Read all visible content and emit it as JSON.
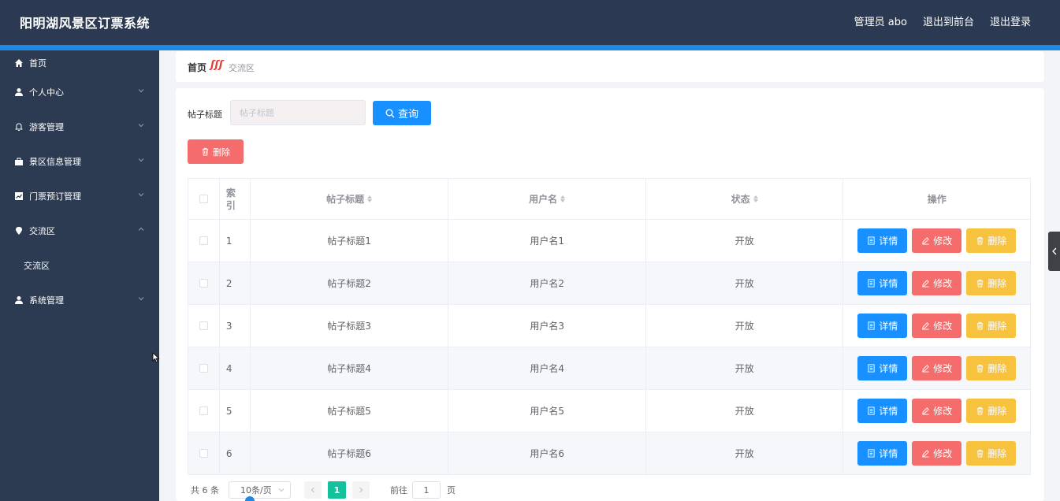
{
  "header": {
    "title": "阳明湖风景区订票系统",
    "admin": "管理员 abo",
    "back_to_front": "退出到前台",
    "logout": "退出登录"
  },
  "sidebar": {
    "items": [
      {
        "label": "首页",
        "icon": "home-icon"
      },
      {
        "label": "个人中心",
        "icon": "user-icon"
      },
      {
        "label": "游客管理",
        "icon": "bell-icon"
      },
      {
        "label": "景区信息管理",
        "icon": "briefcase-icon"
      },
      {
        "label": "门票预订管理",
        "icon": "chart-icon"
      },
      {
        "label": "交流区",
        "icon": "location-icon"
      },
      {
        "label": "交流区",
        "icon": "submenu"
      },
      {
        "label": "系统管理",
        "icon": "user-icon"
      }
    ]
  },
  "breadcrumb": {
    "home": "首页",
    "separator": "ʃʃʃ",
    "current": "交流区"
  },
  "search": {
    "label": "帖子标题",
    "placeholder": "帖子标题",
    "query_button": "查询"
  },
  "toolbar": {
    "delete_button": "删除"
  },
  "table": {
    "headers": {
      "index": "索引",
      "title": "帖子标题",
      "user": "用户名",
      "status": "状态",
      "ops": "操作"
    },
    "rows": [
      {
        "index": "1",
        "title": "帖子标题1",
        "user": "用户名1",
        "status": "开放"
      },
      {
        "index": "2",
        "title": "帖子标题2",
        "user": "用户名2",
        "status": "开放"
      },
      {
        "index": "3",
        "title": "帖子标题3",
        "user": "用户名3",
        "status": "开放"
      },
      {
        "index": "4",
        "title": "帖子标题4",
        "user": "用户名4",
        "status": "开放"
      },
      {
        "index": "5",
        "title": "帖子标题5",
        "user": "用户名5",
        "status": "开放"
      },
      {
        "index": "6",
        "title": "帖子标题6",
        "user": "用户名6",
        "status": "开放"
      }
    ],
    "actions": {
      "detail": "详情",
      "edit": "修改",
      "delete": "删除"
    }
  },
  "pagination": {
    "total": "共 6 条",
    "page_size": "10条/页",
    "current_page": "1",
    "goto_label": "前往",
    "goto_value": "1",
    "page_suffix": "页"
  },
  "colors": {
    "header_bg": "#2b3a52",
    "accent": "#1e88e5",
    "primary": "#1890ff",
    "danger": "#f56c6c",
    "warning": "#f7c23e",
    "page_active": "#13c29c"
  }
}
